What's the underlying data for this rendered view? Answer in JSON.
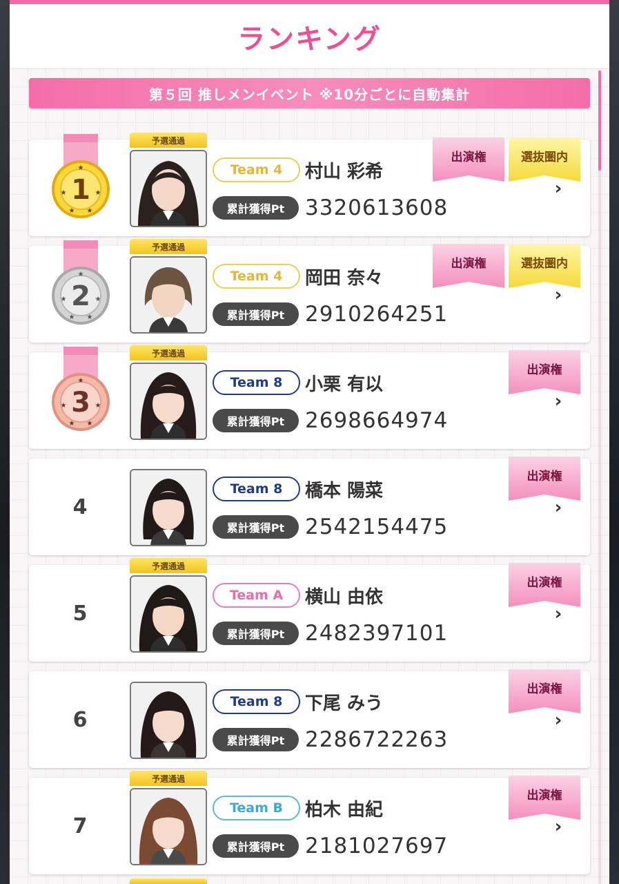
{
  "header": {
    "title": "ランキング"
  },
  "event": {
    "banner": "第５回 推しメンイベント ※10分ごとに自動集計"
  },
  "labels": {
    "prelim": "予選通過",
    "pt_label": "累計獲得Pt",
    "badge_stage": "出演権",
    "badge_selected": "選抜圏内"
  },
  "colors": {
    "accent": "#ee4f91",
    "banner": "#f36ea8",
    "medal_gold": "#f4cd2a",
    "medal_silver": "#c9c9c9",
    "medal_bronze": "#f3b4a6"
  },
  "rankings": [
    {
      "rank": "1",
      "team": "Team 4",
      "name": "村山 彩希",
      "points": "3320613608"
    },
    {
      "rank": "2",
      "team": "Team 4",
      "name": "岡田 奈々",
      "points": "2910264251"
    },
    {
      "rank": "3",
      "team": "Team 8",
      "name": "小栗 有以",
      "points": "2698664974"
    },
    {
      "rank": "4",
      "team": "Team 8",
      "name": "橋本 陽菜",
      "points": "2542154475"
    },
    {
      "rank": "5",
      "team": "Team A",
      "name": "横山 由依",
      "points": "2482397101"
    },
    {
      "rank": "6",
      "team": "Team 8",
      "name": "下尾 みう",
      "points": "2286722263"
    },
    {
      "rank": "7",
      "team": "Team B",
      "name": "柏木 由紀",
      "points": "2181027697"
    }
  ]
}
